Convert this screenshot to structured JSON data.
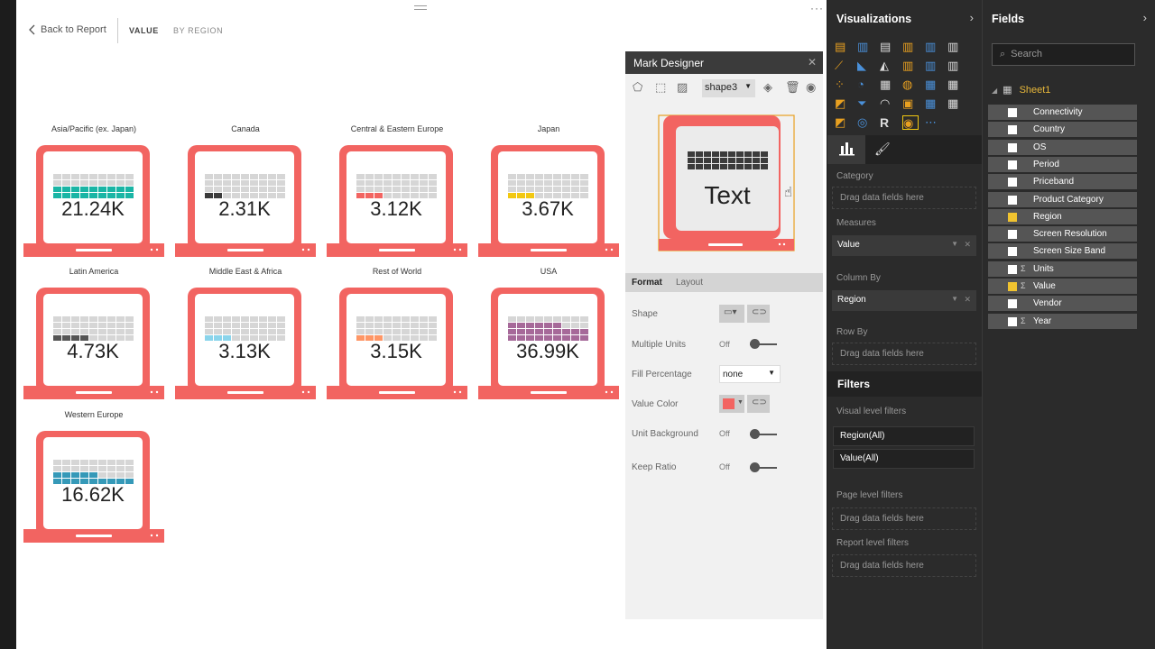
{
  "canvas": {
    "back_label": "Back to Report",
    "breadcrumb_value": "VALUE",
    "breadcrumb_region": "BY REGION",
    "tiles": [
      {
        "region": "Asia/Pacific (ex. Japan)",
        "value": "21.24K",
        "fill_color": "#1ab5a5",
        "filled_units": 18
      },
      {
        "region": "Canada",
        "value": "2.31K",
        "fill_color": "#3b3b3b",
        "filled_units": 2
      },
      {
        "region": "Central & Eastern Europe",
        "value": "3.12K",
        "fill_color": "#f26461",
        "filled_units": 3
      },
      {
        "region": "Japan",
        "value": "3.67K",
        "fill_color": "#f2c811",
        "filled_units": 3
      },
      {
        "region": "Latin America",
        "value": "4.73K",
        "fill_color": "#555555",
        "filled_units": 4
      },
      {
        "region": "Middle East & Africa",
        "value": "3.13K",
        "fill_color": "#8ad4eb",
        "filled_units": 3
      },
      {
        "region": "Rest of World",
        "value": "3.15K",
        "fill_color": "#fe9666",
        "filled_units": 3
      },
      {
        "region": "USA",
        "value": "36.99K",
        "fill_color": "#a66999",
        "filled_units": 24
      },
      {
        "region": "Western Europe",
        "value": "16.62K",
        "fill_color": "#3599b8",
        "filled_units": 14
      }
    ]
  },
  "mark_designer": {
    "title": "Mark Designer",
    "shape_select": "shape3",
    "preview_text": "Text",
    "tab_format": "Format",
    "tab_layout": "Layout",
    "props": {
      "shape": "Shape",
      "multiple_units": "Multiple Units",
      "fill_percentage": "Fill Percentage",
      "value_color": "Value Color",
      "unit_background": "Unit Background",
      "keep_ratio": "Keep Ratio"
    },
    "off_label": "Off",
    "fill_percentage_value": "none",
    "value_color_swatch": "#f26461"
  },
  "visualizations": {
    "title": "Visualizations",
    "category_label": "Category",
    "drag_here": "Drag data fields here",
    "measures_label": "Measures",
    "measure_value": "Value",
    "column_by_label": "Column By",
    "column_by_value": "Region",
    "row_by_label": "Row By",
    "filters_title": "Filters",
    "visual_level_filters": "Visual level filters",
    "filter_region": "Region(All)",
    "filter_value": "Value(All)",
    "page_level_filters": "Page level filters",
    "report_level_filters": "Report level filters"
  },
  "fields": {
    "title": "Fields",
    "search_placeholder": "Search",
    "table_name": "Sheet1",
    "items": [
      {
        "name": "Connectivity",
        "checked": false,
        "sigma": false
      },
      {
        "name": "Country",
        "checked": false,
        "sigma": false
      },
      {
        "name": "OS",
        "checked": false,
        "sigma": false
      },
      {
        "name": "Period",
        "checked": false,
        "sigma": false
      },
      {
        "name": "Priceband",
        "checked": false,
        "sigma": false
      },
      {
        "name": "Product Category",
        "checked": false,
        "sigma": false
      },
      {
        "name": "Region",
        "checked": true,
        "sigma": false
      },
      {
        "name": "Screen Resolution",
        "checked": false,
        "sigma": false
      },
      {
        "name": "Screen Size Band",
        "checked": false,
        "sigma": false
      },
      {
        "name": "Units",
        "checked": false,
        "sigma": true
      },
      {
        "name": "Value",
        "checked": true,
        "sigma": true
      },
      {
        "name": "Vendor",
        "checked": false,
        "sigma": false
      },
      {
        "name": "Year",
        "checked": false,
        "sigma": true
      }
    ]
  },
  "colors": {
    "laptop": "#f26461",
    "accent": "#f2c811"
  }
}
